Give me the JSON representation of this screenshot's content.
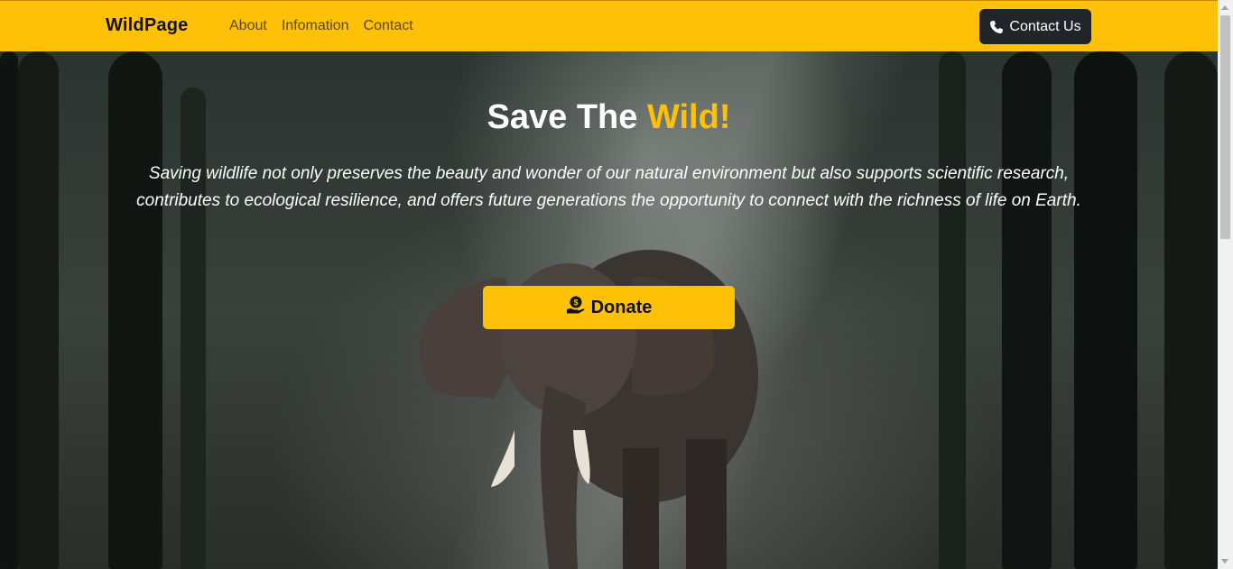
{
  "brand": "WildPage",
  "nav": {
    "links": [
      "About",
      "Infomation",
      "Contact"
    ],
    "contact_button": "Contact Us"
  },
  "hero": {
    "title_main": "Save The ",
    "title_accent": "Wild!",
    "text": "Saving wildlife not only preserves the beauty and wonder of our natural environment but also supports scientific research, contributes to ecological resilience, and offers future generations the opportunity to connect with the richness of life on Earth.",
    "donate_label": "Donate"
  },
  "icons": {
    "contact_button": "phone-icon",
    "donate_button": "hand-holding-dollar-icon"
  },
  "colors": {
    "accent": "#ffc107",
    "dark_button": "#212529"
  }
}
